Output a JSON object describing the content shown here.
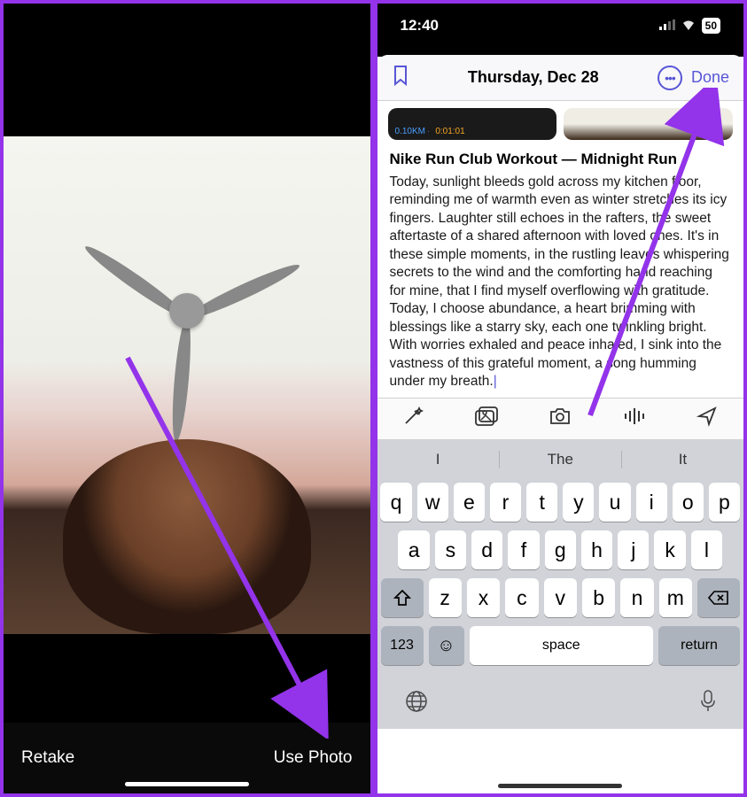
{
  "left": {
    "retake_label": "Retake",
    "use_photo_label": "Use Photo"
  },
  "right": {
    "status_time": "12:40",
    "battery_pct": "50",
    "sheet_title": "Thursday, Dec 28",
    "done_label": "Done",
    "attach_distance": "0.10KM",
    "attach_time": "0:01:01",
    "entry_title": "Nike Run Club Workout — Midnight Run",
    "entry_body": "Today, sunlight bleeds gold across my kitchen floor, reminding me of warmth even as winter stretches its icy fingers. Laughter still echoes in the rafters, the sweet aftertaste of a shared afternoon with loved ones. It's in these simple moments, in the rustling leaves whispering secrets to the wind and the comforting hand reaching for mine, that I find myself overflowing with gratitude. Today, I choose abundance, a heart brimming with blessings like a starry sky, each one twinkling bright. With worries exhaled and peace inhaled, I sink into the vastness of this grateful moment, a song humming under my breath.",
    "predictions": [
      "I",
      "The",
      "It"
    ],
    "keys_r1": [
      "q",
      "w",
      "e",
      "r",
      "t",
      "y",
      "u",
      "i",
      "o",
      "p"
    ],
    "keys_r2": [
      "a",
      "s",
      "d",
      "f",
      "g",
      "h",
      "j",
      "k",
      "l"
    ],
    "keys_r3": [
      "z",
      "x",
      "c",
      "v",
      "b",
      "n",
      "m"
    ],
    "key_123": "123",
    "key_space": "space",
    "key_return": "return"
  }
}
